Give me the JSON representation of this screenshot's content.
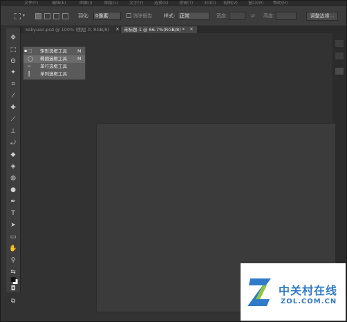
{
  "menu": {
    "items": [
      "文件(F)",
      "编辑(E)",
      "图像(I)",
      "图层(L)",
      "文字(Y)",
      "选择(S)",
      "滤镜(T)",
      "3D(D)",
      "视图(V)",
      "窗口(W)",
      "帮助(H)"
    ]
  },
  "options_bar": {
    "feather_label": "羽化:",
    "feather_value": "0像素",
    "antialias_label": "消除锯齿",
    "style_label": "样式:",
    "style_value": "正常",
    "width_label": "宽度:",
    "height_label": "高度:",
    "refine_button": "调整边缘..."
  },
  "tabs": [
    {
      "title": "kakyuan.psd @ 100% (图层 0, RGB/8)",
      "close": "×",
      "active": false
    },
    {
      "title": "未标题-1 @ 66.7%(RGB/8) *",
      "close": "×",
      "active": true
    }
  ],
  "tools": [
    {
      "name": "move-tool-icon",
      "glyph": "✥"
    },
    {
      "name": "marquee-tool-icon",
      "glyph": "⬚"
    },
    {
      "name": "lasso-tool-icon",
      "glyph": "ʘ"
    },
    {
      "name": "magic-wand-tool-icon",
      "glyph": "✦"
    },
    {
      "name": "crop-tool-icon",
      "glyph": "⌗"
    },
    {
      "name": "eyedropper-tool-icon",
      "glyph": "⁄"
    },
    {
      "name": "healing-brush-tool-icon",
      "glyph": "✚"
    },
    {
      "name": "brush-tool-icon",
      "glyph": "⟋"
    },
    {
      "name": "clone-stamp-tool-icon",
      "glyph": "⊥"
    },
    {
      "name": "history-brush-tool-icon",
      "glyph": "⤾"
    },
    {
      "name": "eraser-tool-icon",
      "glyph": "◆"
    },
    {
      "name": "paint-bucket-tool-icon",
      "glyph": "◈"
    },
    {
      "name": "blur-tool-icon",
      "glyph": "◍"
    },
    {
      "name": "dodge-tool-icon",
      "glyph": "●"
    },
    {
      "name": "pen-tool-icon",
      "glyph": "✒"
    },
    {
      "name": "type-tool-icon",
      "glyph": "T"
    },
    {
      "name": "path-selection-tool-icon",
      "glyph": "➤"
    },
    {
      "name": "shape-tool-icon",
      "glyph": "▭"
    },
    {
      "name": "hand-tool-icon",
      "glyph": "✋"
    },
    {
      "name": "zoom-tool-icon",
      "glyph": "⚲"
    },
    {
      "name": "swap-colors-icon",
      "glyph": "⇆"
    },
    {
      "name": "color-swatches-icon",
      "glyph": "■"
    },
    {
      "name": "quick-mask-icon",
      "glyph": "◘"
    },
    {
      "name": "screen-mode-icon",
      "glyph": "⧉"
    }
  ],
  "flyout": {
    "items": [
      {
        "icon": "⬚",
        "label": "矩形选框工具",
        "key": "M",
        "selected": false
      },
      {
        "icon": "◯",
        "label": "椭圆选框工具",
        "key": "M",
        "selected": true
      },
      {
        "icon": "┅",
        "label": "单行选框工具",
        "key": "",
        "selected": false
      },
      {
        "icon": "┇",
        "label": "单列选框工具",
        "key": "",
        "selected": false
      }
    ]
  },
  "watermark": {
    "cn": "中关村在线",
    "en": "ZOL.COM.CN",
    "colors": {
      "blue": "#2f7bc9",
      "green": "#8dc63f"
    }
  }
}
